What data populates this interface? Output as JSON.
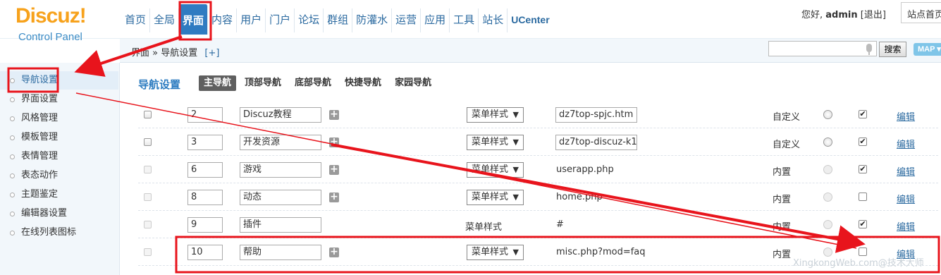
{
  "logo": {
    "brand": "Discuz!",
    "sub": "Control Panel"
  },
  "topnav": [
    "首页",
    "全局",
    "界面",
    "内容",
    "用户",
    "门户",
    "论坛",
    "群组",
    "防灌水",
    "运营",
    "应用",
    "工具",
    "站长",
    "UCenter"
  ],
  "topnav_active_index": 2,
  "user": {
    "greeting": "您好,",
    "name": "admin",
    "logout": "[退出]",
    "site_home": "站点首页"
  },
  "breadcrumb": {
    "section": "界面",
    "sep": "»",
    "page": "导航设置",
    "add": "[+]"
  },
  "search": {
    "placeholder": "",
    "button": "搜索",
    "map": "MAP"
  },
  "sidebar": {
    "items": [
      "导航设置",
      "界面设置",
      "风格管理",
      "模板管理",
      "表情管理",
      "表态动作",
      "主题鉴定",
      "编辑器设置",
      "在线列表图标"
    ],
    "active_index": 0
  },
  "main": {
    "title": "导航设置",
    "tabs": [
      "主导航",
      "顶部导航",
      "底部导航",
      "快捷导航",
      "家园导航"
    ],
    "active_tab": 0,
    "rows": [
      {
        "order": "2",
        "name": "Discuz教程",
        "style": "菜单样式",
        "style_editable": true,
        "url": "dz7top-spjc.htm",
        "url_editable": true,
        "type": "自定义",
        "delete_enabled": true,
        "add_sub": true,
        "checked": true,
        "edit": "编辑"
      },
      {
        "order": "3",
        "name": "开发资源",
        "style": "菜单样式",
        "style_editable": true,
        "url": "dz7top-discuz-k1",
        "url_editable": true,
        "type": "自定义",
        "delete_enabled": true,
        "add_sub": true,
        "checked": true,
        "edit": "编辑"
      },
      {
        "order": "6",
        "name": "游戏",
        "style": "菜单样式",
        "style_editable": true,
        "url": "userapp.php",
        "url_editable": false,
        "type": "内置",
        "delete_enabled": false,
        "add_sub": true,
        "checked": true,
        "edit": "编辑"
      },
      {
        "order": "8",
        "name": "动态",
        "style": "菜单样式",
        "style_editable": true,
        "url": "home.php",
        "url_editable": false,
        "type": "内置",
        "delete_enabled": false,
        "add_sub": true,
        "checked": false,
        "edit": "编辑"
      },
      {
        "order": "9",
        "name": "插件",
        "style": "菜单样式",
        "style_editable": false,
        "url": "#",
        "url_editable": false,
        "type": "内置",
        "delete_enabled": false,
        "add_sub": false,
        "checked": true,
        "edit": "编辑"
      },
      {
        "order": "10",
        "name": "帮助",
        "style": "菜单样式",
        "style_editable": true,
        "url": "misc.php?mod=faq",
        "url_editable": false,
        "type": "内置",
        "delete_enabled": false,
        "add_sub": true,
        "checked": false,
        "edit": "编辑"
      }
    ]
  },
  "watermark": "XingkongWeb.com@技术大师",
  "colors": {
    "annotation": "#e8141c",
    "accent": "#2f7bc1",
    "logo_orange": "#f7a21c"
  }
}
